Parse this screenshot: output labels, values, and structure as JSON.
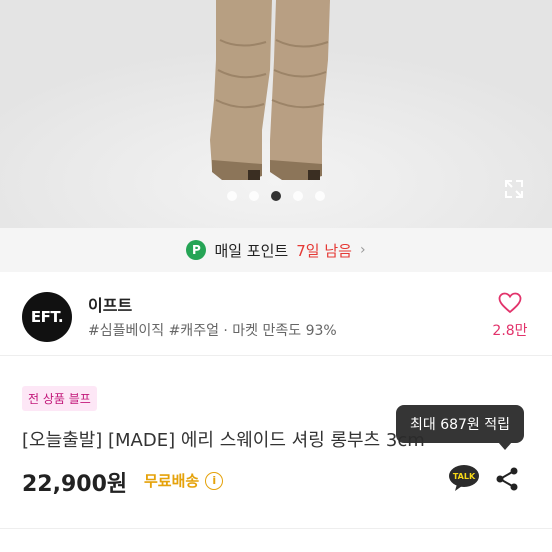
{
  "gallery": {
    "slide_count": 5,
    "active_index": 2
  },
  "point_banner": {
    "badge": "P",
    "text": "매일 포인트",
    "highlight": "7일 남음",
    "chevron": "›"
  },
  "seller": {
    "logo_text": "EFT.",
    "name": "이프트",
    "tags": "#심플베이직 #캐주얼 · 마켓 만족도 93%",
    "like_count": "2.8만"
  },
  "product": {
    "sale_badge": "전 상품 블프",
    "title": "[오늘출발] [MADE] 에리 스웨이드 셔링 롱부츠 3cm",
    "price": "22,900원",
    "shipping": "무료배송",
    "info_icon": "i"
  },
  "tooltip": {
    "text": "최대 687원 적립"
  },
  "actions": {
    "talk_label": "TALK"
  },
  "colors": {
    "accent_red": "#e53935",
    "like_pink": "#e2336b",
    "shipping_yellow": "#e5a20a",
    "point_green": "#25a455"
  }
}
